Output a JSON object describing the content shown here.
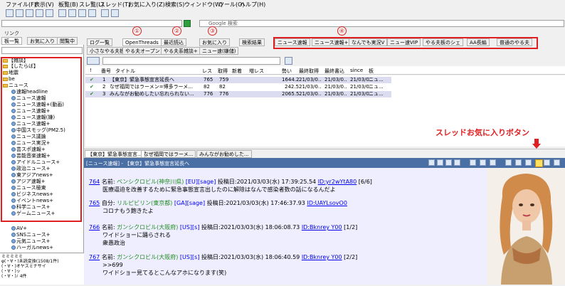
{
  "menu": [
    "ファイル(F)",
    "表示(V)",
    "板覧(B)",
    "スレ覧(L)",
    "スレッド(T)",
    "お気に入り(Z)",
    "検索(S)",
    "ウィンドウ(W)",
    "ツール(O)",
    "ヘルプ(H)"
  ],
  "search": {
    "placeholder": "Google 検索"
  },
  "link_label": "リンク",
  "left_tabs": [
    "板一覧",
    "お気に入り",
    "閲覧中"
  ],
  "tree": [
    "【雑談】",
    "【したらば】",
    "地震",
    "be",
    "ニュース",
    "速報headline",
    "ニュース速報",
    "ニュース速報+(動画)",
    "ニュース速報+",
    "ニュース速報(嫌)",
    "ニュース速報+",
    "中国スモッグ(PM2.5)",
    "ニュース議論",
    "ニュース実況+",
    "芸スポ速報+",
    "芸能音楽速報+",
    "アイドルニュース+",
    "政治ニュース+",
    "東アジアnews+",
    "アジア速報+",
    "ニュース極東",
    "ビジネスnews+",
    "イベントnews+",
    "科学ニュース+",
    "ゲームニュース+",
    "AV+",
    "SNSニュース+",
    "元気ニュース+",
    "ハーガルnews+"
  ],
  "left_log": [
    "ミミミミミ",
    "φ(・∀・)未読変換(1508/1件)",
    "(・∀・)オヤスミナサイ",
    "(・∀・)ッ",
    "(・∀・)ﾉ  4件"
  ],
  "tabs_row1": [
    "ログ一覧",
    "OpenThreads",
    "最近読込",
    "お気に入り",
    "検索結果",
    "ニュース速報",
    "ニュース速報+",
    "なんでも実況V",
    "ニュー速VIP",
    "やる夫板のシェ",
    "AA長編",
    "普通のやる夫"
  ],
  "tabs_row2": [
    "小さなやる夫板",
    "やる夫オープン",
    "やる夫系雑談+",
    "ニュー速(嫌儲)"
  ],
  "circles": [
    "①",
    "②",
    "③",
    "④"
  ],
  "list_headers": [
    "!",
    "番号",
    "タイトル",
    "レス",
    "取得",
    "新着",
    "増レス",
    "勢い",
    "最終取得",
    "最終書込",
    "since",
    "板"
  ],
  "threads": [
    {
      "no": "1",
      "title": "【東京】緊急事態宣言延長へ",
      "res": "765",
      "got": "759",
      "new": "",
      "inc": "",
      "speed": "1644.2",
      "last_get": "21/03/0..",
      "last_post": "21/03/0..",
      "since": "21/03/0..",
      "board": "ニュ..."
    },
    {
      "no": "2",
      "title": "なぜ福岡ではラーメン=博多ラーメ...",
      "res": "82",
      "got": "82",
      "new": "",
      "inc": "",
      "speed": "242.5",
      "last_get": "21/03/0..",
      "last_post": "21/03/0..",
      "since": "21/03/0..",
      "board": "ニュ..."
    },
    {
      "no": "3",
      "title": "みんながお勧めしたい忘れられない...",
      "res": "776",
      "got": "776",
      "new": "",
      "inc": "",
      "speed": "2065.5",
      "last_get": "21/03/0..",
      "last_post": "21/03/0..",
      "since": "21/03/0..",
      "board": "ニュ..."
    }
  ],
  "fav_label": "スレッドお気に入りボタン",
  "viewer_tabs": [
    "【東京】緊急事態宣言...",
    "なぜ福岡ではラーメ...",
    "みんながお勧めした..."
  ],
  "viewer_title": "[ニュース速報] - 【東京】緊急事態宣言延長へ",
  "posts": [
    {
      "num": "764",
      "name_label": "名前:",
      "name": "ベンシクロビル(神奈川県)",
      "mail": "[EU][sage]",
      "date": "投稿日:2021/03/03(水) 17:39:25.54",
      "id": "ID:yr2wYtA80",
      "count": "[6/6]",
      "body": "医療逼迫を改善するために緊急事態宣言出したのに解除はなんで感染者数の話になるんだよ"
    },
    {
      "num": "765",
      "name_label": "自分:",
      "name": "リルピビリン(東京都)",
      "mail": "[GA][sage]",
      "date": "投稿日:2021/03/03(水) 17:46:37.93",
      "id": "ID:UAYLsovO0",
      "count": "",
      "body": "コロナもう飽きたよ"
    },
    {
      "num": "766",
      "name_label": "名前:",
      "name": "ガンシクロビル(大阪府)",
      "mail": "[US][s]",
      "date": "投稿日:2021/03/03(水) 18:06:08.73",
      "id": "ID:Bknrey Y00",
      "count": "[1/2]",
      "body": "ワイドショーに踊らされる\n衆愚政治"
    },
    {
      "num": "767",
      "name_label": "名前:",
      "name": "ガンシクロビル(大阪府)",
      "mail": "[US][s]",
      "date": "投稿日:2021/03/03(水) 18:06:40.59",
      "id": "ID:Bknrey Y00",
      "count": "[2/2]",
      "body": ">>699\nワイドショー見てるとこんなアホになります(笑)"
    }
  ]
}
